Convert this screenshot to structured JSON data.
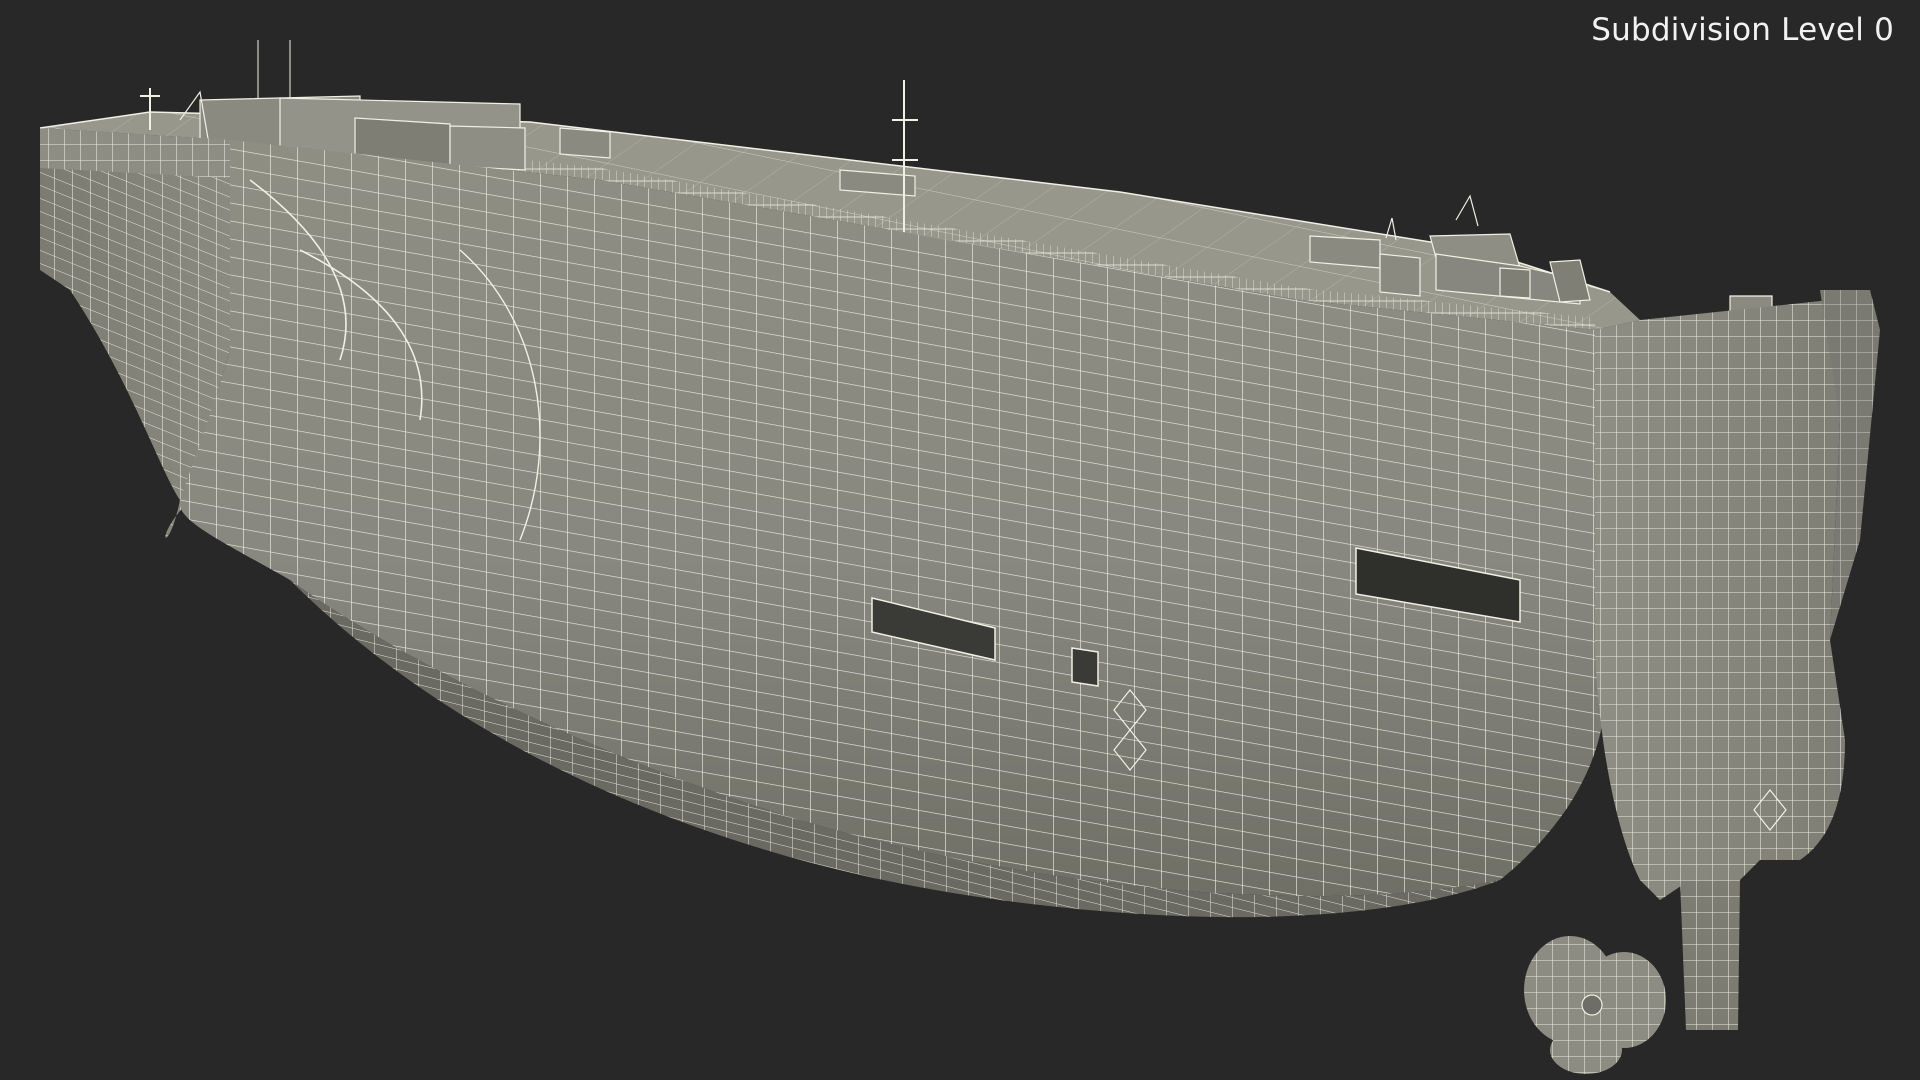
{
  "viewport": {
    "background_color": "#282828",
    "overlay_label": "Subdivision Level 0"
  },
  "model": {
    "subject": "car-carrier-ship-wireframe",
    "surface_color": "#8b8b7f",
    "deck_color": "#96968b",
    "wire_color": "#f1f0e4",
    "shadow_color": "#6c6c61"
  }
}
